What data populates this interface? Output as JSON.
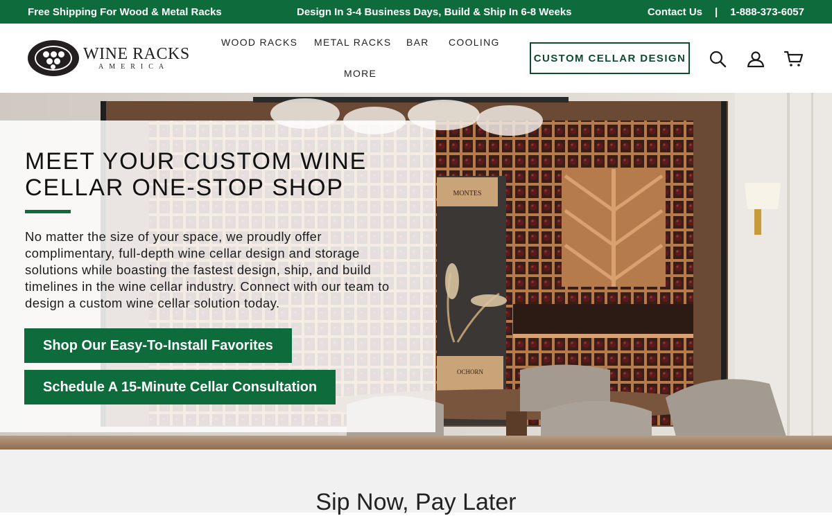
{
  "topbar": {
    "shipping": "Free Shipping For Wood & Metal Racks",
    "timeline": "Design In 3-4 Business Days, Build & Ship In 6-8 Weeks",
    "contact": "Contact Us",
    "divider": "|",
    "phone": "1-888-373-6057"
  },
  "header": {
    "logo_line1": "WINE RACKS",
    "logo_line2": "AMERICA",
    "nav": [
      "WOOD RACKS",
      "METAL RACKS",
      "BAR",
      "COOLING",
      "MORE"
    ],
    "cta": "CUSTOM CELLAR DESIGN",
    "icons": [
      "search-icon",
      "account-icon",
      "cart-icon"
    ]
  },
  "hero": {
    "title_line1": "MEET YOUR CUSTOM WINE",
    "title_line2": "CELLAR ONE-STOP SHOP",
    "body": "No matter the size of your space, we proudly offer complimentary, full-depth wine cellar design and storage solutions while boasting the fastest design, ship, and build timelines in the wine cellar industry. Connect with our team to design a custom wine cellar solution today.",
    "button1": "Shop Our Easy-To-Install Favorites",
    "button2": "Schedule A 15-Minute Cellar Consultation",
    "crate_label_1": "MONTES",
    "crate_label_2": "OCHORN"
  },
  "section": {
    "heading": "Sip Now, Pay Later"
  },
  "colors": {
    "brand_green": "#0d6b3c",
    "dark_green": "#0d4a2e",
    "wood": "#c48a5c"
  }
}
